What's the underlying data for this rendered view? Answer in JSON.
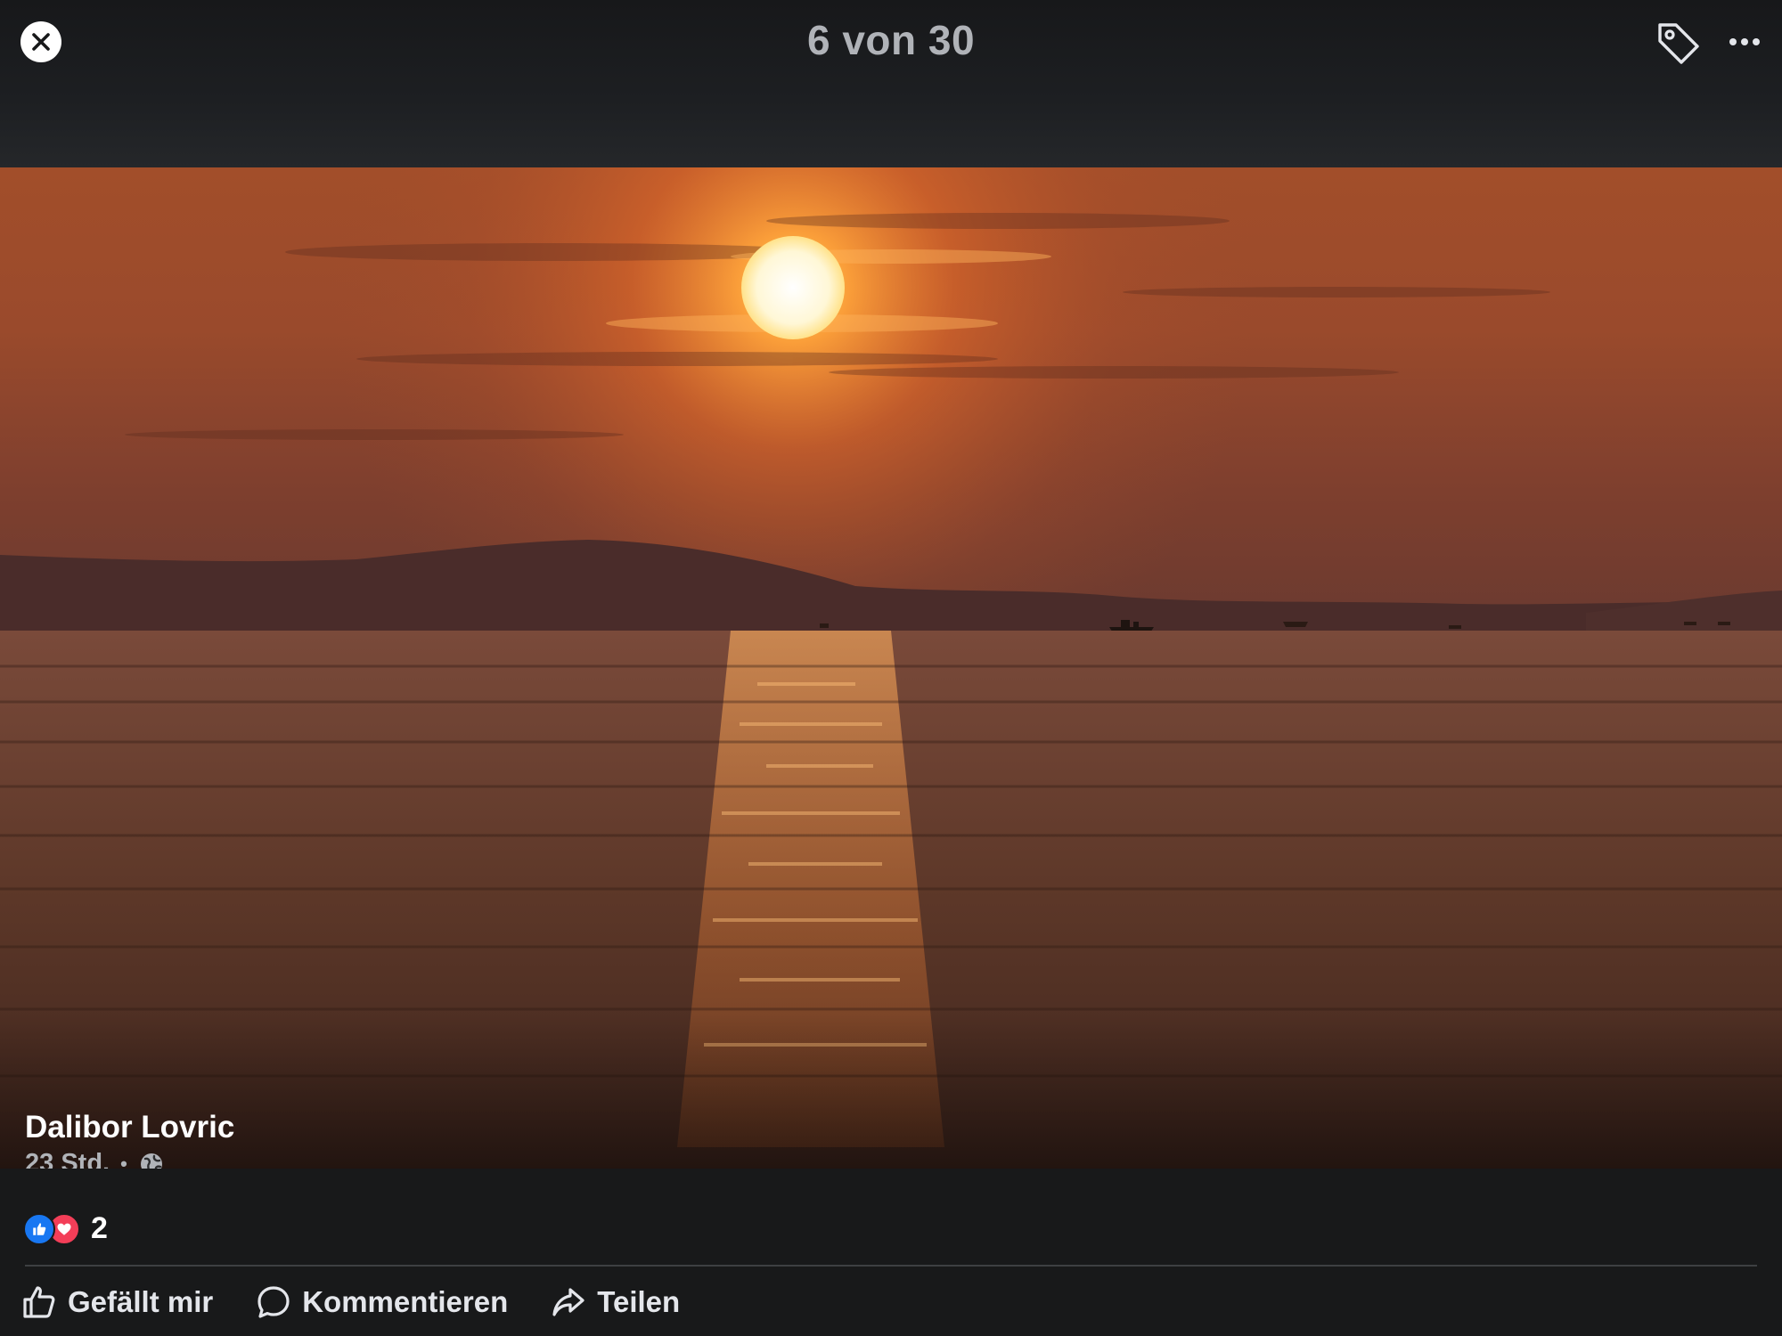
{
  "viewer": {
    "counter": "6 von 30",
    "close_icon": "close-icon",
    "tag_icon": "tag-icon",
    "more_icon": "more-horizontal-icon"
  },
  "post": {
    "author": "Dalibor Lovric",
    "time": "23 Std.",
    "separator": "•",
    "audience_icon": "globe-icon"
  },
  "reactions": {
    "types": [
      "like-icon",
      "love-icon"
    ],
    "count": "2"
  },
  "actions": {
    "like_label": "Gefällt mir",
    "comment_label": "Kommentieren",
    "share_label": "Teilen"
  },
  "colors": {
    "background": "#18191a",
    "like_blue": "#1877f2",
    "love_red": "#f33e58",
    "muted_text": "#b0b3b8",
    "sky_orange": "#c05a2a"
  }
}
